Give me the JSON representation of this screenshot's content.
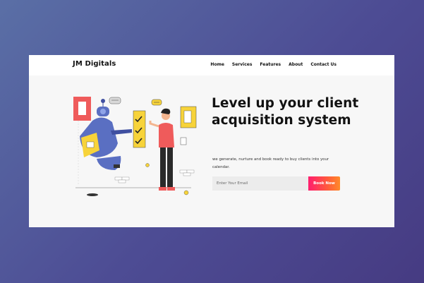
{
  "brand": {
    "name": "JM Digitals"
  },
  "nav": {
    "items": [
      {
        "label": "Home"
      },
      {
        "label": "Services"
      },
      {
        "label": "Features"
      },
      {
        "label": "About"
      },
      {
        "label": "Contact Us"
      }
    ]
  },
  "hero": {
    "title": "Level up your client acquisition system",
    "subtitle": "we generate, nurture and book ready to buy clients into your calendar.",
    "email_placeholder": "Enter Your Email",
    "cta_label": "Book Now"
  },
  "colors": {
    "cta_gradient_start": "#ff1e6e",
    "cta_gradient_end": "#ff8a2a",
    "robot_blue": "#5a6fc2",
    "accent_yellow": "#f7d33a",
    "shirt_red": "#ef5b5b"
  },
  "icons": {
    "illustration": "robot-and-man-checklist-illustration"
  }
}
